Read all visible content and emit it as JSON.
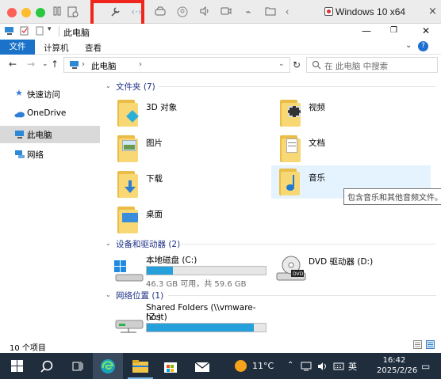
{
  "vm": {
    "window_title": "Windows 10 x64",
    "highlight_color": "#f0261c"
  },
  "explorer": {
    "title": "此电脑",
    "ribbon": {
      "file_tab": "文件",
      "tab_computer": "计算机",
      "tab_view": "查看"
    },
    "address": {
      "crumb": "此电脑",
      "separator": "›",
      "search_placeholder": "在 此电脑 中搜索"
    },
    "sidebar": [
      {
        "label": "快速访问",
        "icon": "star-icon"
      },
      {
        "label": "OneDrive",
        "icon": "cloud-icon"
      },
      {
        "label": "此电脑",
        "icon": "computer-icon",
        "selected": true
      },
      {
        "label": "网络",
        "icon": "network-icon"
      }
    ],
    "groups": {
      "folders": {
        "label": "文件夹 (7)"
      },
      "devices": {
        "label": "设备和驱动器 (2)"
      },
      "network": {
        "label": "网络位置 (1)"
      }
    },
    "folders": [
      {
        "label": "3D 对象",
        "icon": "3d-objects-folder-icon"
      },
      {
        "label": "视频",
        "icon": "videos-folder-icon"
      },
      {
        "label": "图片",
        "icon": "pictures-folder-icon"
      },
      {
        "label": "文档",
        "icon": "documents-folder-icon"
      },
      {
        "label": "下载",
        "icon": "downloads-folder-icon"
      },
      {
        "label": "音乐",
        "icon": "music-folder-icon"
      },
      {
        "label": "桌面",
        "icon": "desktop-folder-icon"
      }
    ],
    "tooltip": "包含音乐和其他音频文件。",
    "drives": [
      {
        "label": "本地磁盘 (C:)",
        "detail": "46.3 GB 可用，共 59.6 GB",
        "used_fraction": 0.22
      },
      {
        "label": "DVD 驱动器 (D:)"
      }
    ],
    "network_locations": [
      {
        "label": "Shared Folders (\\\\vmware-host)",
        "label2": "(Z:)",
        "used_fraction": 0.9
      }
    ],
    "status": "10 个项目"
  },
  "taskbar": {
    "weather": "11°C",
    "ime": "英",
    "time": "16:42",
    "date": "2025/2/26"
  }
}
